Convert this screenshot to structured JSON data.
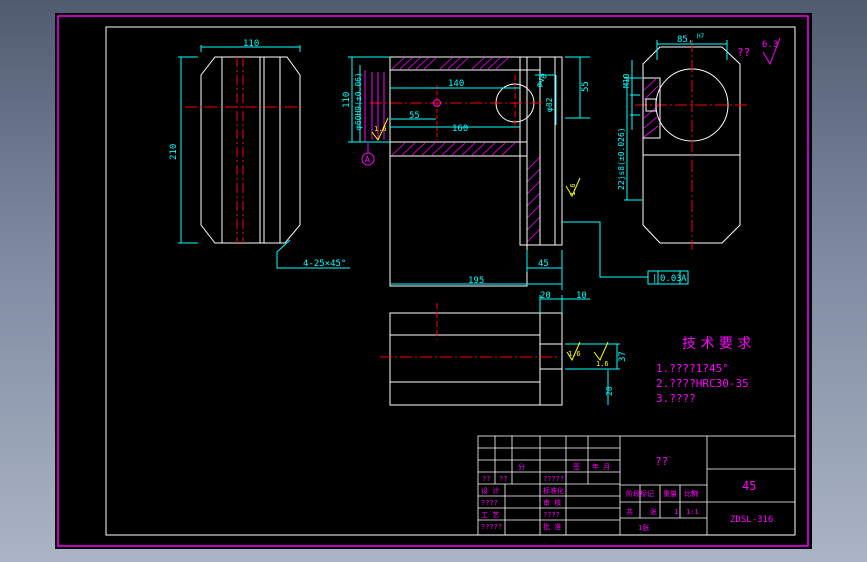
{
  "colors": {
    "paper": "#000000",
    "frame": "#ff00ff",
    "inner_frame": "#ffffff",
    "dim": "#00ffff",
    "outline": "#ffffff",
    "center": "#ff0000",
    "hatch": "#ff00ff",
    "note": "#ff00ff",
    "green": "#00ff00",
    "yellow": "#ffff00"
  },
  "dims": {
    "top_width": "110",
    "left_height": "210",
    "chamfer": "4-25×45°",
    "front_140": "140",
    "front_55": "55",
    "front_160": "160",
    "front_110": "110",
    "front_phi40": "φ40",
    "front_phi82": "φ82",
    "front_phi60": "φ60",
    "front_slot": "φ60H9(±0.06)",
    "front_55_right": "55",
    "front_45": "45",
    "front_195": "195",
    "roughness_1": "1.6",
    "roughness_2": "1.6",
    "datum": "A",
    "right_85": "85,",
    "right_85_sup": "H7",
    "right_m10": "M10",
    "right_22": "22js8(±0.026)",
    "right_rough": "6.3",
    "right_rough_qm": "??",
    "tolerance_val": "0.03",
    "tolerance_ref": "A",
    "tolerance_sym": "|",
    "bot_20": "20",
    "bot_10": "10",
    "bot_37": "37",
    "bot_20v": "20",
    "bot_rough1": "1.6",
    "bot_rough2": "1.6"
  },
  "notes": {
    "title": "技 术 要 求",
    "line1": "1.????1?45°",
    "line2": "2.????HRC30-35",
    "line3": "3.????"
  },
  "title_block": {
    "part_name": "??",
    "material": "45",
    "drawing_no": "ZDSL-316",
    "c1": "??",
    "c2": "??",
    "c3": "分",
    "c4": "?????",
    "c5": "签",
    "c6": "年 月",
    "c7": "设 计",
    "c8": "标准化",
    "c9": "????",
    "c10": "审 核",
    "c11": "????",
    "c12": "工 艺",
    "c13": "批 准",
    "c14": "?????",
    "c15": "阶段标记",
    "c16": "重量",
    "c17": "比例",
    "c18": "??",
    "c19": "共",
    "c20": "张",
    "c21": "1",
    "c22": "1:1",
    "c23": "1张"
  }
}
